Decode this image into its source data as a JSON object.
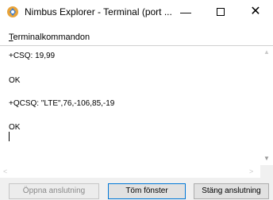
{
  "window": {
    "title": "Nimbus Explorer - Terminal (port ...",
    "min_glyph": "—",
    "close_glyph": "✕",
    "icon": "nimbus-app-icon"
  },
  "menu": {
    "item_underlined": "T",
    "item_rest": "erminalkommandon"
  },
  "terminal": {
    "lines": [
      "+CSQ: 19,99",
      "OK",
      "+QCSQ: \"LTE\",76,-106,85,-19",
      "OK"
    ]
  },
  "scroll": {
    "up_glyph": "▲",
    "down_glyph": "▼",
    "left_glyph": "<",
    "right_glyph": ">"
  },
  "buttons": {
    "open": "Öppna anslutning",
    "clear": "Töm fönster",
    "close": "Stäng anslutning"
  },
  "colors": {
    "accent": "#0078d7",
    "disabled_text": "#8a8a8a"
  }
}
